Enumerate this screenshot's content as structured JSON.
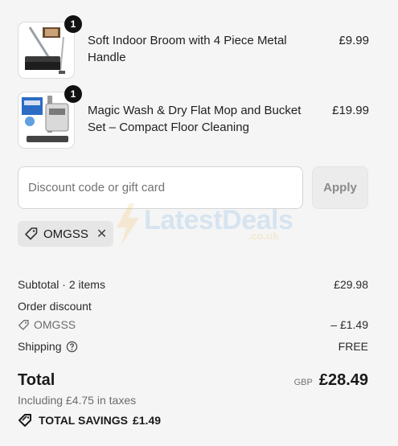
{
  "cart": {
    "items": [
      {
        "name": "Soft Indoor Broom with 4 Piece Metal Handle",
        "price": "£9.99",
        "quantity": "1",
        "image_icon": "broom-product-image"
      },
      {
        "name": "Magic Wash & Dry Flat Mop and Bucket Set – Compact Floor Cleaning",
        "price": "£19.99",
        "quantity": "1",
        "image_icon": "mop-bucket-product-image"
      }
    ]
  },
  "discount": {
    "placeholder": "Discount code or gift card",
    "apply_label": "Apply",
    "applied_code": "OMGSS",
    "tag_icon": "tag-icon",
    "remove_icon": "close-icon",
    "remove_symbol": "✕"
  },
  "watermark": {
    "brand": "LatestDeals",
    "domain": ".co.uk"
  },
  "summary": {
    "subtotal_label": "Subtotal · 2 items",
    "subtotal_value": "£29.98",
    "order_discount_label": "Order discount",
    "discount_code": "OMGSS",
    "discount_value": "– £1.49",
    "shipping_label": "Shipping",
    "shipping_help_icon": "help-circle-icon",
    "shipping_value": "FREE",
    "total_label": "Total",
    "currency": "GBP",
    "total_value": "£28.49",
    "taxes_text": "Including £4.75 in taxes",
    "savings_label": "TOTAL SAVINGS",
    "savings_value": "£1.49",
    "savings_icon": "savings-tag-icon"
  },
  "colors": {
    "background": "#f5f5f5",
    "badge": "#111111",
    "chip": "#e6e6e6",
    "watermark_blue": "#3b8fd9",
    "watermark_orange": "#f0a623"
  }
}
